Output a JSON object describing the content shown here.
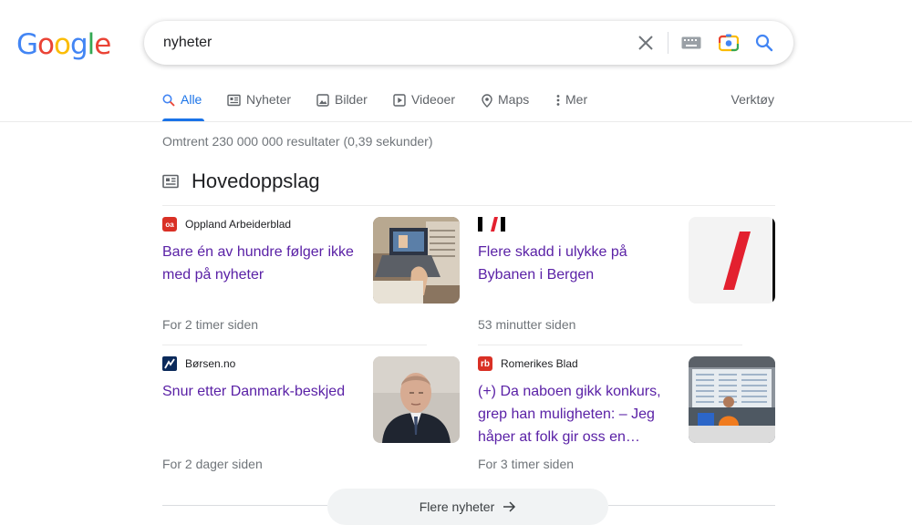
{
  "logo": {
    "letters": [
      "G",
      "o",
      "o",
      "g",
      "l",
      "e"
    ],
    "colors": [
      "#4285F4",
      "#EA4335",
      "#FBBC05",
      "#4285F4",
      "#34A853",
      "#EA4335"
    ]
  },
  "search": {
    "query": "nyheter"
  },
  "tabs": [
    {
      "label": "Alle",
      "icon": "search-icon"
    },
    {
      "label": "Nyheter",
      "icon": "news-icon"
    },
    {
      "label": "Bilder",
      "icon": "image-icon"
    },
    {
      "label": "Videoer",
      "icon": "play-icon"
    },
    {
      "label": "Maps",
      "icon": "map-pin-icon"
    },
    {
      "label": "Mer",
      "icon": "more-vert-icon"
    }
  ],
  "tools_label": "Verktøy",
  "result_stats": "Omtrent 230 000 000 resultater (0,39 sekunder)",
  "section_title": "Hovedoppslag",
  "articles": [
    {
      "source": "Oppland Arbeiderblad",
      "source_logo": "oa",
      "logo_color": "#d93025",
      "headline": "Bare én av hundre følger ikke med på nyheter",
      "time": "For 2 timer siden"
    },
    {
      "source": "",
      "source_logo": "dn-slash",
      "logo_color": "#000000",
      "headline": "Flere skadd i ulykke på Bybanen i Bergen",
      "time": "53 minutter siden"
    },
    {
      "source": "Børsen.no",
      "source_logo": "borsen",
      "logo_color": "#0b2a5b",
      "headline": "Snur etter Danmark-beskjed",
      "time": "For 2 dager siden"
    },
    {
      "source": "Romerikes Blad",
      "source_logo": "rb",
      "logo_color": "#d93025",
      "headline": "(+) Da naboen gikk konkurs, grep han muligheten: – Jeg håper at folk gir oss en…",
      "time": "For 3 timer siden"
    }
  ],
  "more_news": "Flere nyheter"
}
